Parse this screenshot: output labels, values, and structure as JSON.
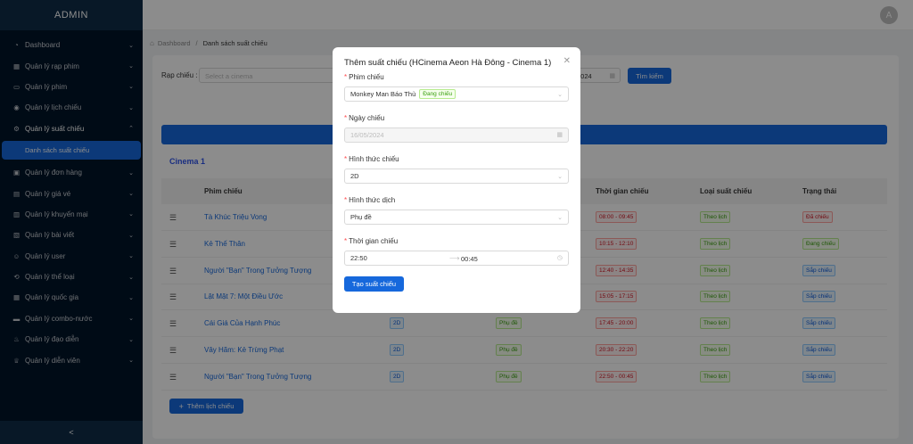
{
  "sidebar": {
    "brand": "ADMIN",
    "items": [
      {
        "label": "Dashboard",
        "icon": "dashboard-icon"
      },
      {
        "label": "Quản lý rạp phim",
        "icon": "building-icon"
      },
      {
        "label": "Quản lý phim",
        "icon": "film-icon"
      },
      {
        "label": "Quản lý lịch chiếu",
        "icon": "location-icon"
      },
      {
        "label": "Quản lý suất chiếu",
        "icon": "settings-icon"
      },
      {
        "label": "Quản lý đơn hàng",
        "icon": "cart-icon"
      },
      {
        "label": "Quản lý giá vé",
        "icon": "ticket-icon"
      },
      {
        "label": "Quản lý khuyến mại",
        "icon": "gift-icon"
      },
      {
        "label": "Quản lý bài viết",
        "icon": "article-icon"
      },
      {
        "label": "Quản lý user",
        "icon": "user-icon"
      },
      {
        "label": "Quản lý thể loại",
        "icon": "category-icon"
      },
      {
        "label": "Quản lý quốc gia",
        "icon": "globe-icon"
      },
      {
        "label": "Quản lý combo-nước",
        "icon": "combo-icon"
      },
      {
        "label": "Quản lý đạo diễn",
        "icon": "director-icon"
      },
      {
        "label": "Quản lý diễn viên",
        "icon": "trophy-icon"
      }
    ],
    "sub_item": "Danh sách suất chiếu",
    "collapse_symbol": "<"
  },
  "header": {
    "avatar": "A"
  },
  "breadcrumb": {
    "home": "Dashboard",
    "current": "Danh sách suất chiếu"
  },
  "filter": {
    "label": "Rạp chiếu :",
    "placeholder": "Select a cinema",
    "date_value": "2024",
    "search": "Tìm kiếm"
  },
  "cinema_title": "Cinema 1",
  "table": {
    "headers": [
      "Phim chiếu",
      "Thời gian chiếu",
      "Loại suất chiếu",
      "Trạng thái"
    ],
    "rows": [
      {
        "movie": "Tà Khúc Triệu Vong",
        "format": "",
        "sub": "",
        "time": "08:00 - 09:45",
        "type": "Theo lịch",
        "status": "Đã chiếu",
        "status_color": "red"
      },
      {
        "movie": "Kẻ Thế Thân",
        "format": "",
        "sub": "",
        "time": "10:15 - 12:10",
        "type": "Theo lịch",
        "status": "Đang chiếu",
        "status_color": "green"
      },
      {
        "movie": "Người \"Bạn\" Trong Tưởng Tượng",
        "format": "",
        "sub": "",
        "time": "12:40 - 14:35",
        "type": "Theo lịch",
        "status": "Sắp chiếu",
        "status_color": "blue"
      },
      {
        "movie": "Lật Mặt 7: Một Điều Ước",
        "format": "",
        "sub": "",
        "time": "15:05 - 17:15",
        "type": "Theo lịch",
        "status": "Sắp chiếu",
        "status_color": "blue"
      },
      {
        "movie": "Cái Giá Của Hạnh Phúc",
        "format": "2D",
        "sub": "Phụ đề",
        "time": "17:45 - 20:00",
        "type": "Theo lịch",
        "status": "Sắp chiếu",
        "status_color": "blue"
      },
      {
        "movie": "Vây Hãm: Kẻ Trừng Phạt",
        "format": "2D",
        "sub": "Phụ đề",
        "time": "20:30 - 22:20",
        "type": "Theo lịch",
        "status": "Sắp chiếu",
        "status_color": "blue"
      },
      {
        "movie": "Người \"Bạn\" Trong Tưởng Tượng",
        "format": "2D",
        "sub": "Phụ đề",
        "time": "22:50 - 00:45",
        "type": "Theo lịch",
        "status": "Sắp chiếu",
        "status_color": "blue"
      }
    ]
  },
  "add_button": "Thêm lịch chiếu",
  "modal": {
    "title": "Thêm suất chiếu (HCinema Aeon Hà Đông - Cinema 1)",
    "movie_label": "Phim chiếu",
    "movie_value": "Monkey Man Báo Thù",
    "movie_tag": "Đang chiếu",
    "date_label": "Ngày chiếu",
    "date_value": "16/05/2024",
    "format_label": "Hình thức chiếu",
    "format_value": "2D",
    "translate_label": "Hình thức dịch",
    "translate_value": "Phụ đề",
    "time_label": "Thời gian chiếu",
    "time_start": "22:50",
    "time_end": "00:45",
    "submit": "Tạo suất chiếu"
  },
  "colors": {
    "primary": "#1668dc",
    "sidebar": "#001529"
  }
}
